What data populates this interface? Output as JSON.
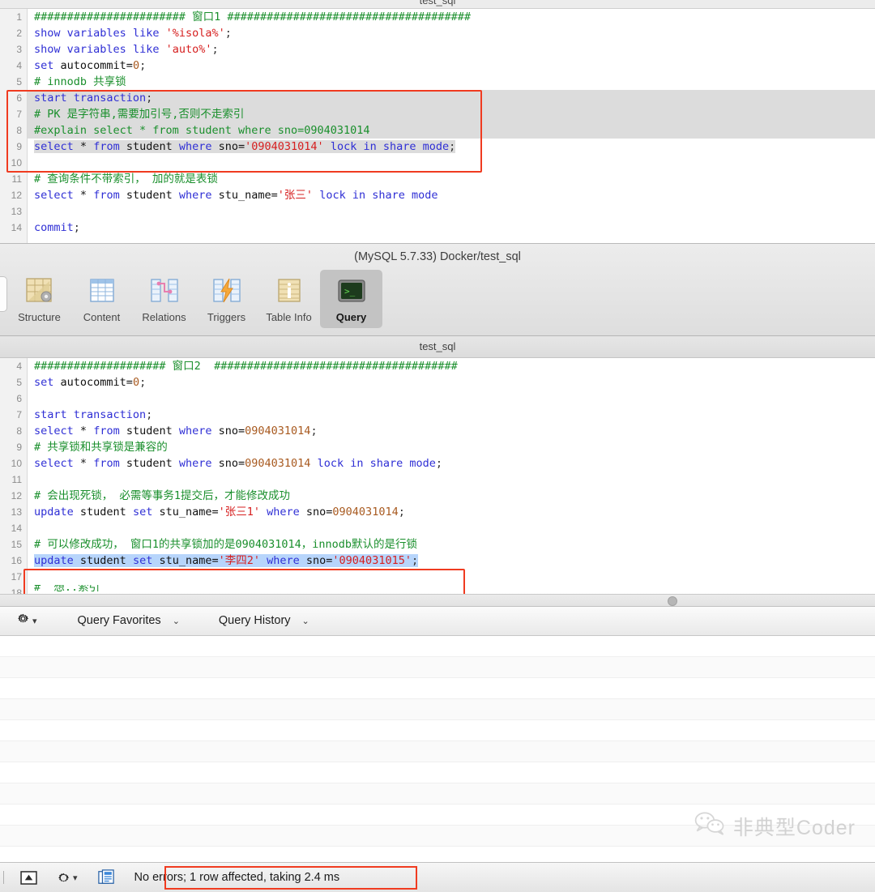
{
  "window": {
    "clipped_title": "test_sql",
    "database_line": "(MySQL 5.7.33) Docker/test_sql",
    "second_pane_title": "test_sql"
  },
  "tabs": [
    {
      "label": "Structure",
      "icon": "structure-icon",
      "selected": false
    },
    {
      "label": "Content",
      "icon": "table-grid-icon",
      "selected": false
    },
    {
      "label": "Relations",
      "icon": "relations-icon",
      "selected": false
    },
    {
      "label": "Triggers",
      "icon": "triggers-icon",
      "selected": false
    },
    {
      "label": "Table Info",
      "icon": "table-info-icon",
      "selected": false
    },
    {
      "label": "Query",
      "icon": "terminal-icon",
      "selected": true
    }
  ],
  "editor_top": {
    "lines": [
      {
        "n": "1",
        "text": "####################### 窗口1 #####################################"
      },
      {
        "n": "2",
        "text": "show variables like '%isola%';"
      },
      {
        "n": "3",
        "text": "show variables like 'auto%';"
      },
      {
        "n": "4",
        "text": "set autocommit=0;"
      },
      {
        "n": "5",
        "text": "# innodb 共享锁"
      },
      {
        "n": "6",
        "text": "start transaction;"
      },
      {
        "n": "7",
        "text": "# PK 是字符串,需要加引号,否则不走索引"
      },
      {
        "n": "8",
        "text": "#explain select * from student where sno=0904031014"
      },
      {
        "n": "9",
        "text": "select * from student where sno='0904031014' lock in share mode;"
      },
      {
        "n": "10",
        "text": ""
      },
      {
        "n": "11",
        "text": "# 查询条件不带索引， 加的就是表锁"
      },
      {
        "n": "12",
        "text": "select * from student where stu_name='张三' lock in share mode"
      },
      {
        "n": "13",
        "text": ""
      },
      {
        "n": "14",
        "text": "commit;"
      }
    ]
  },
  "editor_bottom": {
    "lines": [
      {
        "n": "4",
        "text": "#################### 窗口2  #####################################"
      },
      {
        "n": "5",
        "text": "set autocommit=0;"
      },
      {
        "n": "6",
        "text": ""
      },
      {
        "n": "7",
        "text": "start transaction;"
      },
      {
        "n": "8",
        "text": "select * from student where sno=0904031014;"
      },
      {
        "n": "9",
        "text": "# 共享锁和共享锁是兼容的"
      },
      {
        "n": "10",
        "text": "select * from student where sno=0904031014 lock in share mode;"
      },
      {
        "n": "11",
        "text": ""
      },
      {
        "n": "12",
        "text": "# 会出现死锁， 必需等事务1提交后，才能修改成功"
      },
      {
        "n": "13",
        "text": "update student set stu_name='张三1' where sno=0904031014;"
      },
      {
        "n": "14",
        "text": ""
      },
      {
        "n": "15",
        "text": "# 可以修改成功， 窗口1的共享锁加的是0904031014，innodb默认的是行锁"
      },
      {
        "n": "16",
        "text": "update student set stu_name='李四2' where sno='0904031015';"
      },
      {
        "n": "17",
        "text": ""
      },
      {
        "n": "18",
        "text": ""
      }
    ]
  },
  "query_bar": {
    "gear_label": "",
    "favorites_label": "Query Favorites",
    "history_label": "Query History",
    "chevron": "⌄"
  },
  "status_bar": {
    "message": "No errors; 1 row affected, taking 2.4 ms"
  },
  "watermark": {
    "text": "非典型Coder"
  },
  "colors": {
    "keyword": "#2f2fd5",
    "comment": "#1a8f2c",
    "string": "#d62020",
    "number": "#a85a20",
    "annotation_red": "#f03b20",
    "selection_gray": "#dcdcdc",
    "selection_blue": "#b7d5fb"
  }
}
